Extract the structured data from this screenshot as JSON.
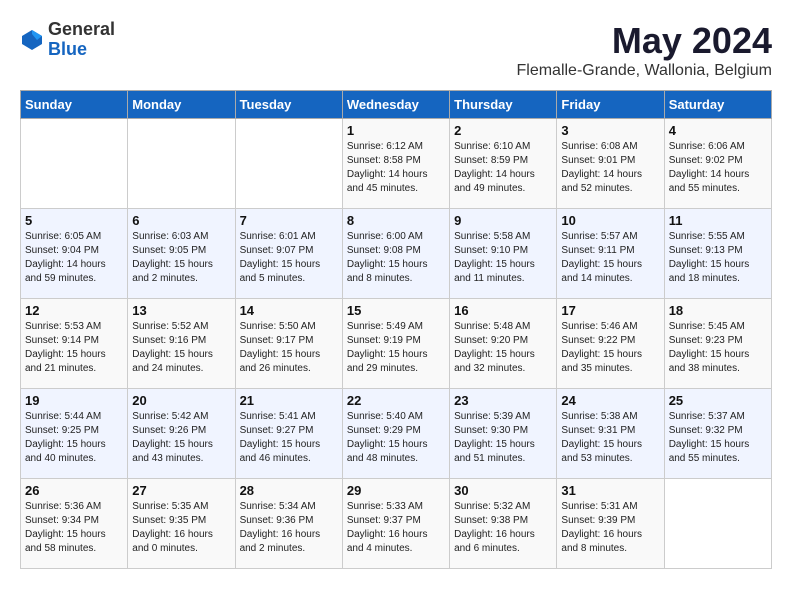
{
  "header": {
    "logo_general": "General",
    "logo_blue": "Blue",
    "month_year": "May 2024",
    "location": "Flemalle-Grande, Wallonia, Belgium"
  },
  "weekdays": [
    "Sunday",
    "Monday",
    "Tuesday",
    "Wednesday",
    "Thursday",
    "Friday",
    "Saturday"
  ],
  "weeks": [
    [
      {
        "day": "",
        "sunrise": "",
        "sunset": "",
        "daylight": ""
      },
      {
        "day": "",
        "sunrise": "",
        "sunset": "",
        "daylight": ""
      },
      {
        "day": "",
        "sunrise": "",
        "sunset": "",
        "daylight": ""
      },
      {
        "day": "1",
        "sunrise": "Sunrise: 6:12 AM",
        "sunset": "Sunset: 8:58 PM",
        "daylight": "Daylight: 14 hours and 45 minutes."
      },
      {
        "day": "2",
        "sunrise": "Sunrise: 6:10 AM",
        "sunset": "Sunset: 8:59 PM",
        "daylight": "Daylight: 14 hours and 49 minutes."
      },
      {
        "day": "3",
        "sunrise": "Sunrise: 6:08 AM",
        "sunset": "Sunset: 9:01 PM",
        "daylight": "Daylight: 14 hours and 52 minutes."
      },
      {
        "day": "4",
        "sunrise": "Sunrise: 6:06 AM",
        "sunset": "Sunset: 9:02 PM",
        "daylight": "Daylight: 14 hours and 55 minutes."
      }
    ],
    [
      {
        "day": "5",
        "sunrise": "Sunrise: 6:05 AM",
        "sunset": "Sunset: 9:04 PM",
        "daylight": "Daylight: 14 hours and 59 minutes."
      },
      {
        "day": "6",
        "sunrise": "Sunrise: 6:03 AM",
        "sunset": "Sunset: 9:05 PM",
        "daylight": "Daylight: 15 hours and 2 minutes."
      },
      {
        "day": "7",
        "sunrise": "Sunrise: 6:01 AM",
        "sunset": "Sunset: 9:07 PM",
        "daylight": "Daylight: 15 hours and 5 minutes."
      },
      {
        "day": "8",
        "sunrise": "Sunrise: 6:00 AM",
        "sunset": "Sunset: 9:08 PM",
        "daylight": "Daylight: 15 hours and 8 minutes."
      },
      {
        "day": "9",
        "sunrise": "Sunrise: 5:58 AM",
        "sunset": "Sunset: 9:10 PM",
        "daylight": "Daylight: 15 hours and 11 minutes."
      },
      {
        "day": "10",
        "sunrise": "Sunrise: 5:57 AM",
        "sunset": "Sunset: 9:11 PM",
        "daylight": "Daylight: 15 hours and 14 minutes."
      },
      {
        "day": "11",
        "sunrise": "Sunrise: 5:55 AM",
        "sunset": "Sunset: 9:13 PM",
        "daylight": "Daylight: 15 hours and 18 minutes."
      }
    ],
    [
      {
        "day": "12",
        "sunrise": "Sunrise: 5:53 AM",
        "sunset": "Sunset: 9:14 PM",
        "daylight": "Daylight: 15 hours and 21 minutes."
      },
      {
        "day": "13",
        "sunrise": "Sunrise: 5:52 AM",
        "sunset": "Sunset: 9:16 PM",
        "daylight": "Daylight: 15 hours and 24 minutes."
      },
      {
        "day": "14",
        "sunrise": "Sunrise: 5:50 AM",
        "sunset": "Sunset: 9:17 PM",
        "daylight": "Daylight: 15 hours and 26 minutes."
      },
      {
        "day": "15",
        "sunrise": "Sunrise: 5:49 AM",
        "sunset": "Sunset: 9:19 PM",
        "daylight": "Daylight: 15 hours and 29 minutes."
      },
      {
        "day": "16",
        "sunrise": "Sunrise: 5:48 AM",
        "sunset": "Sunset: 9:20 PM",
        "daylight": "Daylight: 15 hours and 32 minutes."
      },
      {
        "day": "17",
        "sunrise": "Sunrise: 5:46 AM",
        "sunset": "Sunset: 9:22 PM",
        "daylight": "Daylight: 15 hours and 35 minutes."
      },
      {
        "day": "18",
        "sunrise": "Sunrise: 5:45 AM",
        "sunset": "Sunset: 9:23 PM",
        "daylight": "Daylight: 15 hours and 38 minutes."
      }
    ],
    [
      {
        "day": "19",
        "sunrise": "Sunrise: 5:44 AM",
        "sunset": "Sunset: 9:25 PM",
        "daylight": "Daylight: 15 hours and 40 minutes."
      },
      {
        "day": "20",
        "sunrise": "Sunrise: 5:42 AM",
        "sunset": "Sunset: 9:26 PM",
        "daylight": "Daylight: 15 hours and 43 minutes."
      },
      {
        "day": "21",
        "sunrise": "Sunrise: 5:41 AM",
        "sunset": "Sunset: 9:27 PM",
        "daylight": "Daylight: 15 hours and 46 minutes."
      },
      {
        "day": "22",
        "sunrise": "Sunrise: 5:40 AM",
        "sunset": "Sunset: 9:29 PM",
        "daylight": "Daylight: 15 hours and 48 minutes."
      },
      {
        "day": "23",
        "sunrise": "Sunrise: 5:39 AM",
        "sunset": "Sunset: 9:30 PM",
        "daylight": "Daylight: 15 hours and 51 minutes."
      },
      {
        "day": "24",
        "sunrise": "Sunrise: 5:38 AM",
        "sunset": "Sunset: 9:31 PM",
        "daylight": "Daylight: 15 hours and 53 minutes."
      },
      {
        "day": "25",
        "sunrise": "Sunrise: 5:37 AM",
        "sunset": "Sunset: 9:32 PM",
        "daylight": "Daylight: 15 hours and 55 minutes."
      }
    ],
    [
      {
        "day": "26",
        "sunrise": "Sunrise: 5:36 AM",
        "sunset": "Sunset: 9:34 PM",
        "daylight": "Daylight: 15 hours and 58 minutes."
      },
      {
        "day": "27",
        "sunrise": "Sunrise: 5:35 AM",
        "sunset": "Sunset: 9:35 PM",
        "daylight": "Daylight: 16 hours and 0 minutes."
      },
      {
        "day": "28",
        "sunrise": "Sunrise: 5:34 AM",
        "sunset": "Sunset: 9:36 PM",
        "daylight": "Daylight: 16 hours and 2 minutes."
      },
      {
        "day": "29",
        "sunrise": "Sunrise: 5:33 AM",
        "sunset": "Sunset: 9:37 PM",
        "daylight": "Daylight: 16 hours and 4 minutes."
      },
      {
        "day": "30",
        "sunrise": "Sunrise: 5:32 AM",
        "sunset": "Sunset: 9:38 PM",
        "daylight": "Daylight: 16 hours and 6 minutes."
      },
      {
        "day": "31",
        "sunrise": "Sunrise: 5:31 AM",
        "sunset": "Sunset: 9:39 PM",
        "daylight": "Daylight: 16 hours and 8 minutes."
      },
      {
        "day": "",
        "sunrise": "",
        "sunset": "",
        "daylight": ""
      }
    ]
  ]
}
